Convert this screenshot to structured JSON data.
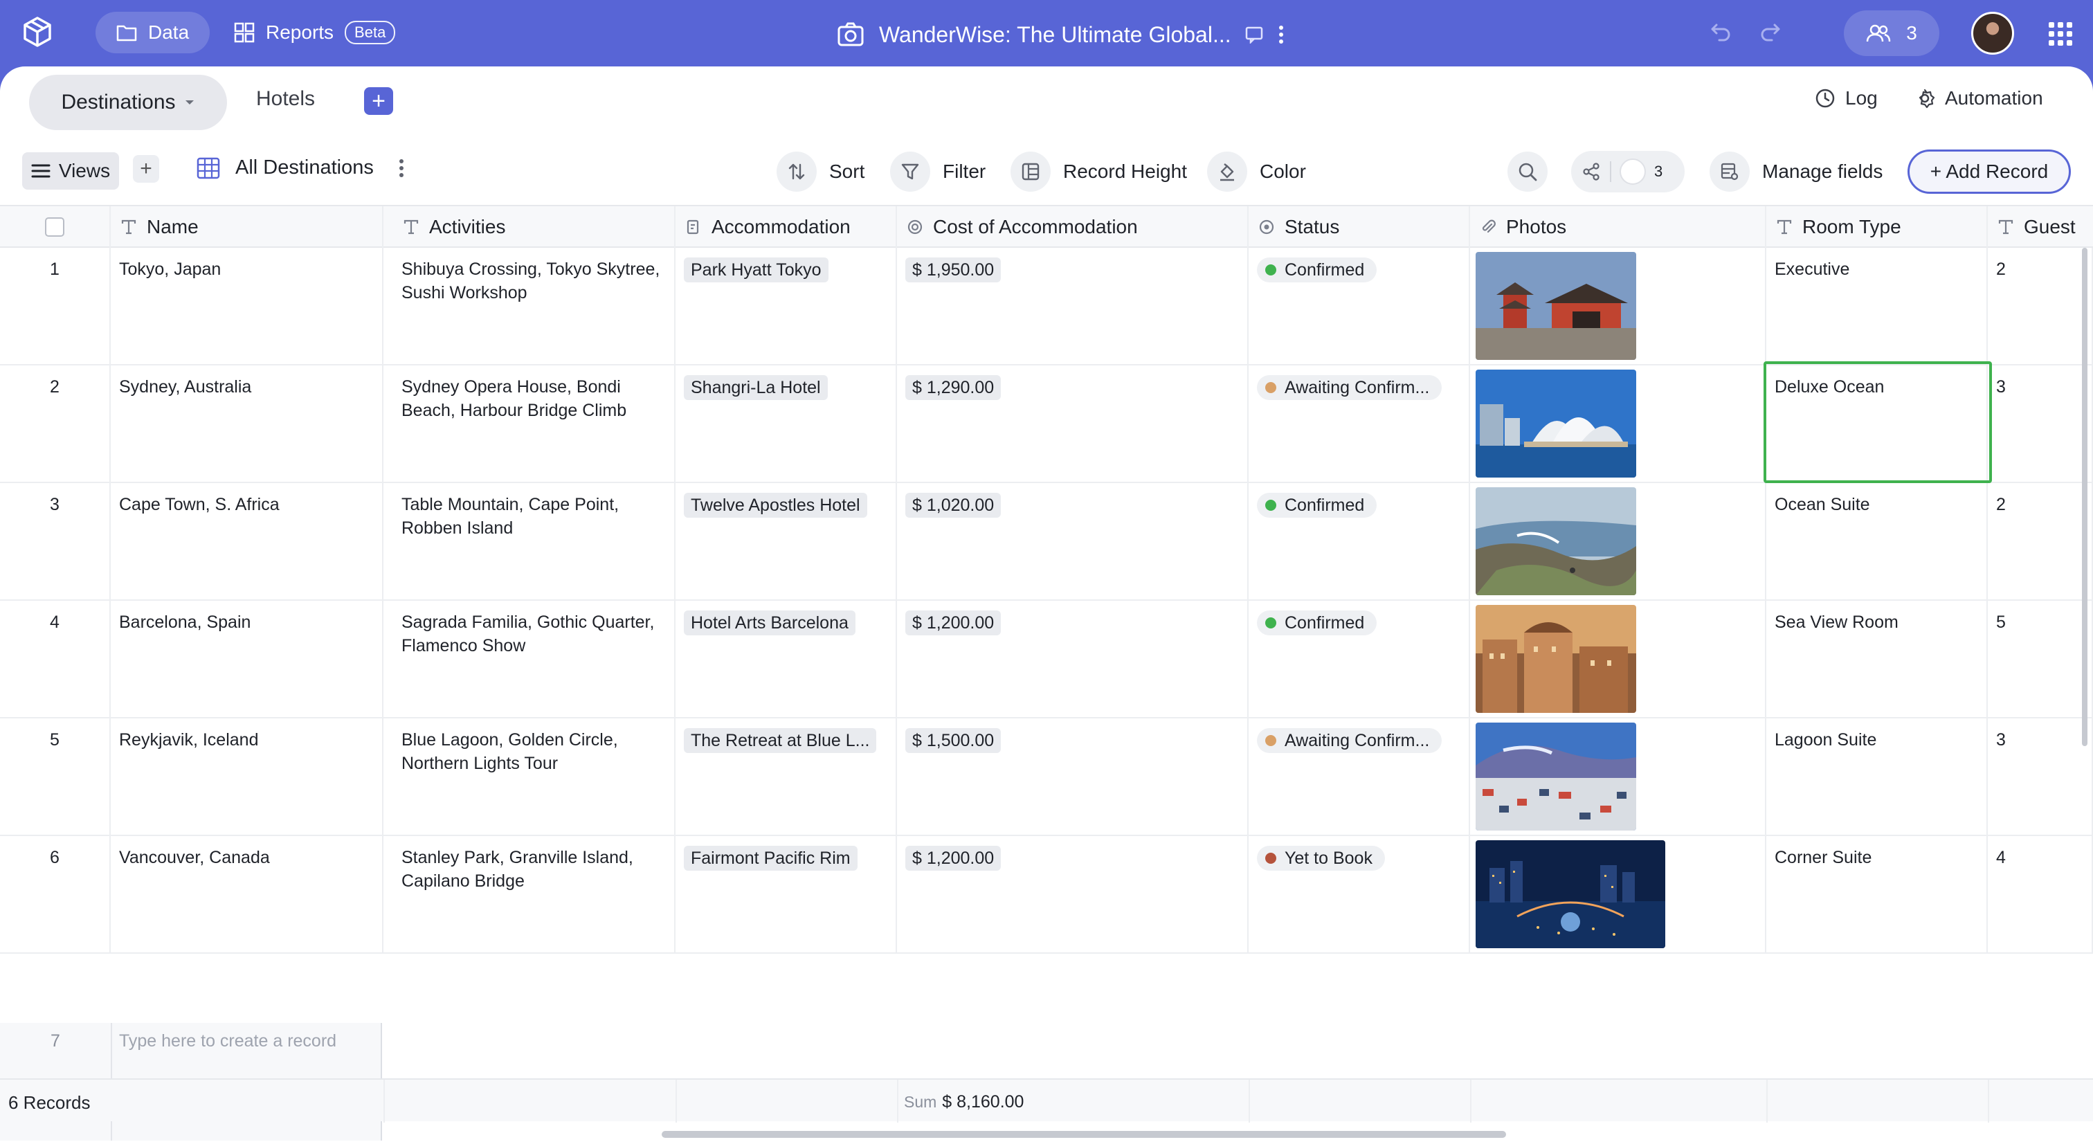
{
  "topbar": {
    "nav_data": "Data",
    "nav_reports": "Reports",
    "reports_badge": "Beta",
    "title": "WanderWise: The Ultimate Global...",
    "collaborators_count": "3"
  },
  "tabs": {
    "active": "Destinations",
    "other": "Hotels",
    "add_symbol": "+"
  },
  "header_actions": {
    "log": "Log",
    "automation": "Automation"
  },
  "toolbar": {
    "views": "Views",
    "view_name": "All Destinations",
    "sort": "Sort",
    "filter": "Filter",
    "record_height": "Record Height",
    "color": "Color",
    "share_count": "3",
    "manage_fields": "Manage fields",
    "add_record": "+ Add Record"
  },
  "columns": [
    "Name",
    "Activities",
    "Accommodation",
    "Cost of Accommodation",
    "Status",
    "Photos",
    "Room Type",
    "Guest"
  ],
  "status_colors": {
    "Confirmed": "#3fb24e",
    "Awaiting Confirm...": "#d9a066",
    "Yet to Book": "#b5533c"
  },
  "rows": [
    {
      "n": "1",
      "name": "Tokyo, Japan",
      "activities": "Shibuya Crossing, Tokyo Skytree, Sushi Workshop",
      "accommodation": "Park Hyatt Tokyo",
      "cost": "$ 1,950.00",
      "status": "Confirmed",
      "photo": "tokyo-temple-photo",
      "room": "Executive",
      "guests": "2"
    },
    {
      "n": "2",
      "name": "Sydney, Australia",
      "activities": "Sydney Opera House, Bondi Beach, Harbour Bridge Climb",
      "accommodation": "Shangri-La Hotel",
      "cost": "$ 1,290.00",
      "status": "Awaiting Confirm...",
      "photo": "sydney-opera-house-photo",
      "room": "Deluxe Ocean",
      "guests": "3"
    },
    {
      "n": "3",
      "name": "Cape Town, S. Africa",
      "activities": "Table Mountain, Cape Point, Robben Island",
      "accommodation": "Twelve Apostles Hotel",
      "cost": "$ 1,020.00",
      "status": "Confirmed",
      "photo": "cape-point-coast-photo",
      "room": "Ocean Suite",
      "guests": "2"
    },
    {
      "n": "4",
      "name": "Barcelona, Spain",
      "activities": "Sagrada Familia, Gothic Quarter, Flamenco Show",
      "accommodation": "Hotel Arts Barcelona",
      "cost": "$ 1,200.00",
      "status": "Confirmed",
      "photo": "barcelona-city-photo",
      "room": "Sea View Room",
      "guests": "5"
    },
    {
      "n": "5",
      "name": "Reykjavik, Iceland",
      "activities": "Blue Lagoon, Golden Circle, Northern Lights Tour",
      "accommodation": "The Retreat at Blue L...",
      "cost": "$ 1,500.00",
      "status": "Awaiting Confirm...",
      "photo": "reykjavik-town-photo",
      "room": "Lagoon Suite",
      "guests": "3"
    },
    {
      "n": "6",
      "name": "Vancouver, Canada",
      "activities": "Stanley Park, Granville Island, Capilano Bridge",
      "accommodation": "Fairmont Pacific Rim",
      "cost": "$ 1,200.00",
      "status": "Yet to Book",
      "photo": "vancouver-night-photo",
      "room": "Corner Suite",
      "guests": "4"
    }
  ],
  "new_row": {
    "n": "7",
    "placeholder": "Type here to create a record"
  },
  "footer": {
    "records": "6 Records",
    "sum_label": "Sum",
    "sum_value": "$ 8,160.00"
  }
}
